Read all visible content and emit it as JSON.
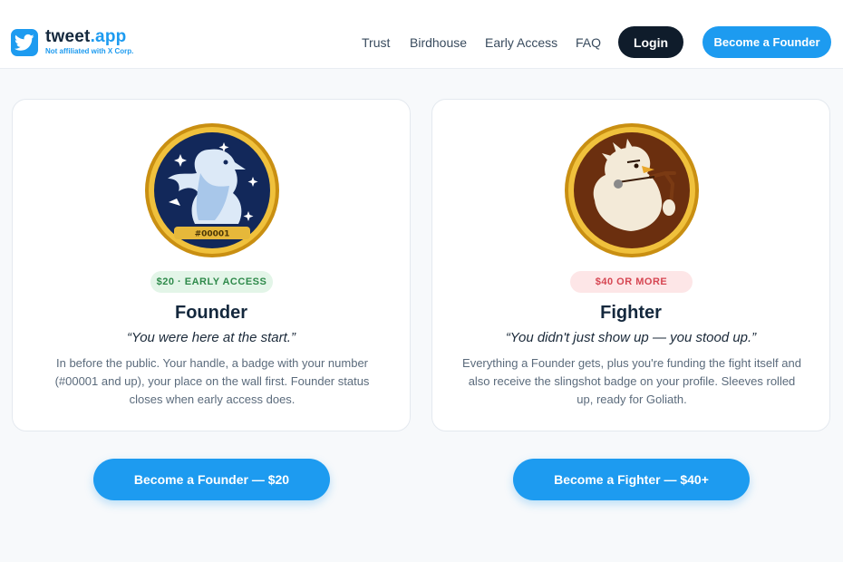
{
  "brand": {
    "name_part1": "tweet",
    "name_part2": ".app",
    "tagline": "Not affiliated with X Corp."
  },
  "nav": {
    "items": [
      "Trust",
      "Birdhouse",
      "Early Access",
      "FAQ"
    ],
    "login": "Login",
    "cta": "Become a Founder"
  },
  "cards": [
    {
      "pill": "$20 · EARLY ACCESS",
      "title": "Founder",
      "quote": "“You were here at the start.”",
      "description": "In before the public. Your handle, a badge with your number (#00001 and up), your place on the wall first. Founder status closes when early access does.",
      "badge_number": "#00001",
      "cta": "Become a Founder — $20"
    },
    {
      "pill": "$40 OR MORE",
      "title": "Fighter",
      "quote": "“You didn't just show up — you stood up.”",
      "description": "Everything a Founder gets, plus you're funding the fight itself and also receive the slingshot badge on your profile. Sleeves rolled up, ready for Goliath.",
      "cta": "Become a Fighter — $40+"
    }
  ],
  "colors": {
    "accent": "#1d9bf0",
    "dark": "#0f1c2b",
    "green_pill": "#2f8a4b",
    "red_pill": "#d64652",
    "gold": "#d9a41e"
  },
  "icons": {
    "logo": "bird-logo-icon",
    "founder_badge": "phoenix-badge-icon",
    "fighter_badge": "slingshot-bird-badge-icon"
  }
}
